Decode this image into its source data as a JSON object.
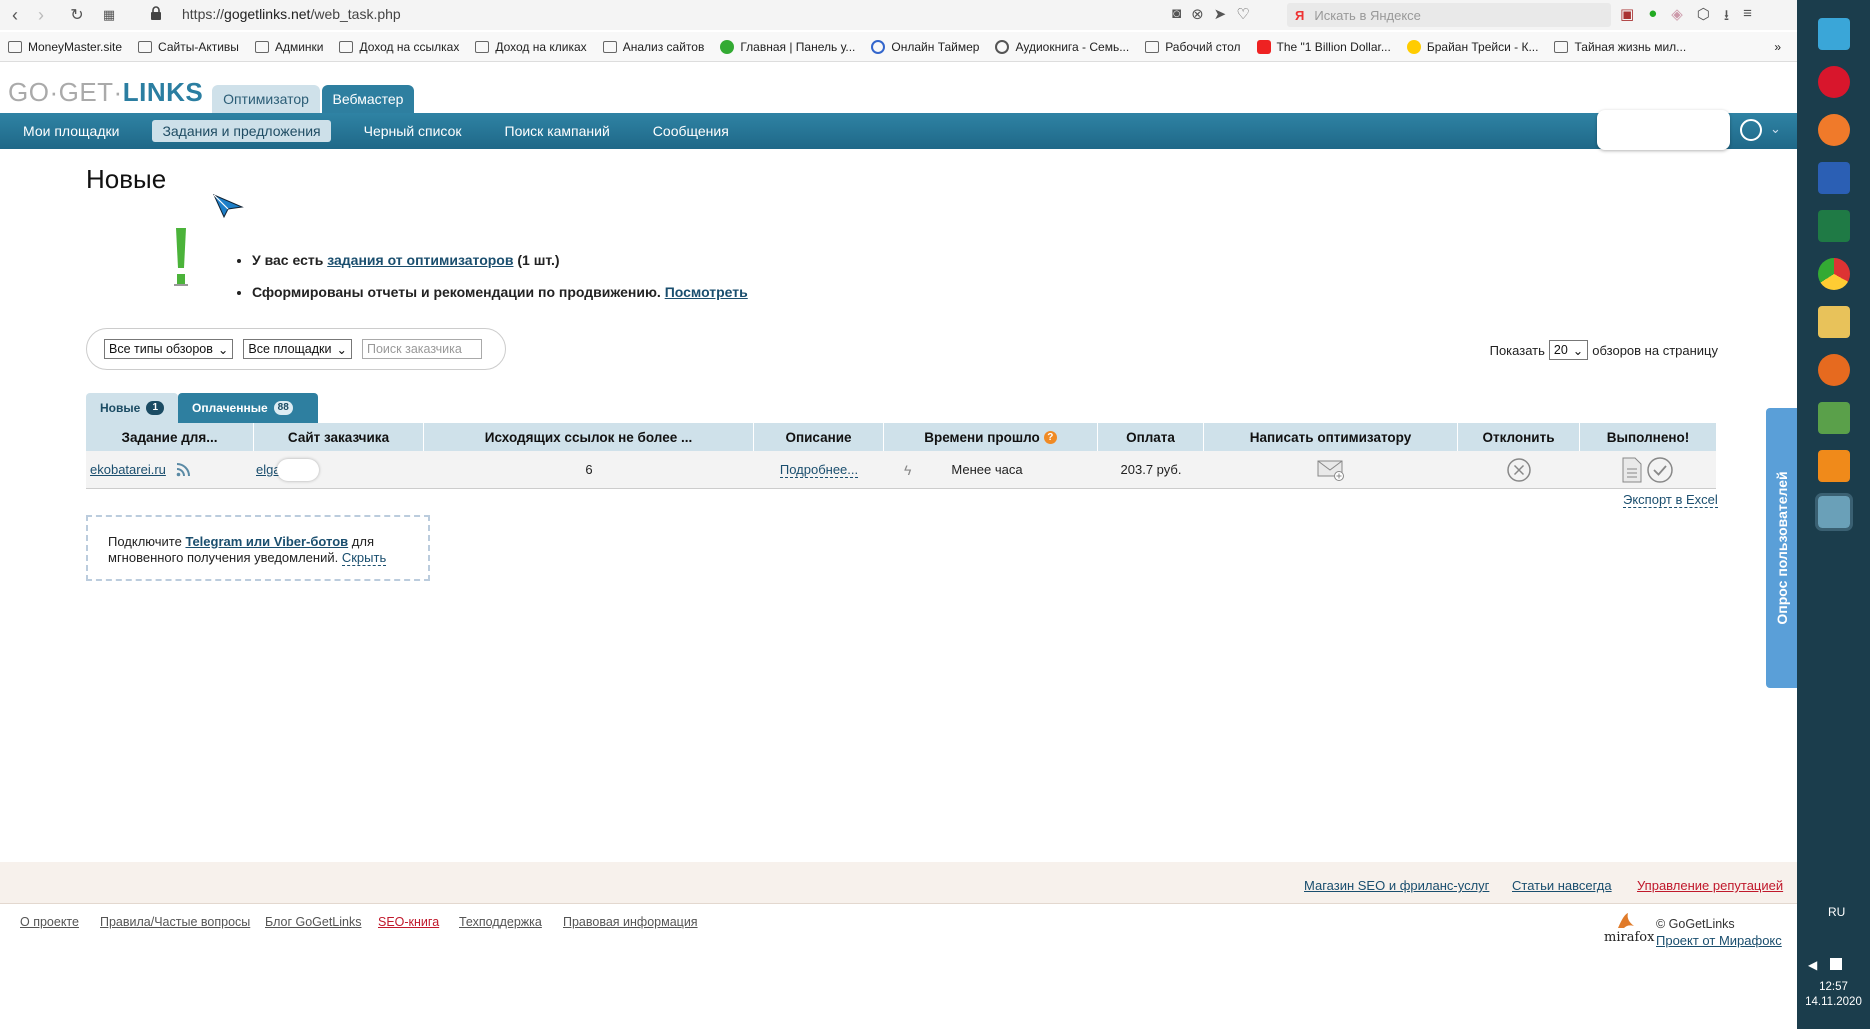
{
  "browser": {
    "url_prefix": "https://",
    "url_domain": "gogetlinks.net",
    "url_path": "/web_task.php",
    "search_placeholder": "Искать в Яндексе",
    "search_logo": "Я",
    "bookmarks": [
      "MoneyMaster.site",
      "Сайты-Активы",
      "Админки",
      "Доход на ссылках",
      "Доход на кликах",
      "Анализ сайтов",
      "Главная | Панель у...",
      "Онлайн Таймер",
      "Аудиокнига - Семь...",
      "Рабочий стол",
      "The \"1 Billion Dollar...",
      "Брайан Трейси - К...",
      "Тайная жизнь мил..."
    ],
    "more": "»"
  },
  "site": {
    "logo_left": "GO·GET·",
    "logo_right": "LINKS",
    "role_tabs": [
      "Оптимизатор",
      "Вебмастер"
    ],
    "nav": [
      "Мои площадки",
      "Задания и предложения",
      "Черный список",
      "Поиск кампаний",
      "Сообщения"
    ],
    "nav_active_index": 1
  },
  "page": {
    "title": "Новые",
    "notice1_prefix": "У вас есть",
    "notice1_link": "задания от оптимизаторов",
    "notice1_suffix": "(1 шт.)",
    "notice2_text": "Сформированы отчеты и рекомендации по продвижению.",
    "notice2_link": "Посмотреть"
  },
  "filters": {
    "review_types": "Все типы обзоров",
    "sites": "Все площадки",
    "search_placeholder": "Поиск заказчика",
    "show_label": "Показать",
    "per_page": "20",
    "per_page_suffix": "обзоров на страницу"
  },
  "tabs": [
    {
      "label": "Новые",
      "count": "1"
    },
    {
      "label": "Оплаченные",
      "count": "88"
    }
  ],
  "table": {
    "columns": [
      "Задание для...",
      "Сайт заказчика",
      "Исходящих ссылок не более ...",
      "Описание",
      "Времени прошло",
      "Оплата",
      "Написать оптимизатору",
      "Отклонить",
      "Выполнено!"
    ],
    "rows": [
      {
        "site": "ekobatarei.ru",
        "customer": "elgaz",
        "links": "6",
        "description": "Подробнее...",
        "elapsed": "Менее часа",
        "payment": "203.7 руб."
      }
    ],
    "export": "Экспорт в Excel"
  },
  "telegram": {
    "prefix": "Подключите",
    "link": "Telegram или Viber-ботов",
    "suffix": "для мгновенного получения уведомлений.",
    "hide": "Скрыть"
  },
  "footer": {
    "top_links": [
      "Магазин SEO и фриланс-услуг",
      "Статьи навсегда",
      "Управление репутацией"
    ],
    "bottom_links": [
      "О проекте",
      "Правила/Частые вопросы",
      "Блог GoGetLinks",
      "SEO-книга",
      "Техподдержка",
      "Правовая информация"
    ],
    "copyright": "© GoGetLinks",
    "mirafox_link": "Проект от Мирафокс",
    "mirafox_logo": "mirafox"
  },
  "survey": "Опрос пользователей",
  "taskbar": {
    "lang": "RU",
    "time": "12:57",
    "date": "14.11.2020"
  },
  "colors": {
    "brand": "#2e7fa0",
    "nav_dark": "#1f6888",
    "light_blue": "#cfe1ea",
    "link": "#1a4e6e",
    "red_link": "#c0182b",
    "exclaim": "#4bb33a"
  }
}
